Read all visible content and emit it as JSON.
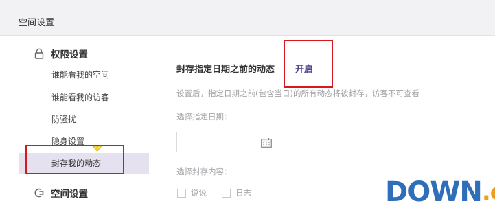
{
  "header": {
    "title": "空间设置"
  },
  "sidebar": {
    "group1_title": "权限设置",
    "items": [
      {
        "label": "谁能看我的空间"
      },
      {
        "label": "谁能看我的访客"
      },
      {
        "label": "防骚扰"
      },
      {
        "label": "隐身设置"
      },
      {
        "label": "封存我的动态"
      }
    ],
    "group2_title": "空间设置"
  },
  "main": {
    "setting_label": "封存指定日期之前的动态",
    "toggle_label": "开启",
    "description": "设置后，指定日期之前(包含当日)的所有动态将被封存，访客不可查看",
    "date_label": "选择指定日期：",
    "date_value": "",
    "content_label": "选择封存内容：",
    "options": [
      {
        "label": "说说"
      },
      {
        "label": "日志"
      }
    ]
  },
  "watermark": {
    "main": "DOWN",
    "suffix": ".cc"
  },
  "colors": {
    "accent": "#4a3d8f",
    "highlight_box": "#d9171f",
    "active_bg": "#e6e1ee",
    "header_bg": "#f2f2f4",
    "crown": "#f5d218"
  },
  "icons": {
    "group1": "lock-icon",
    "group2": "space-icon",
    "vip": "crown-icon",
    "date": "calendar-icon"
  }
}
